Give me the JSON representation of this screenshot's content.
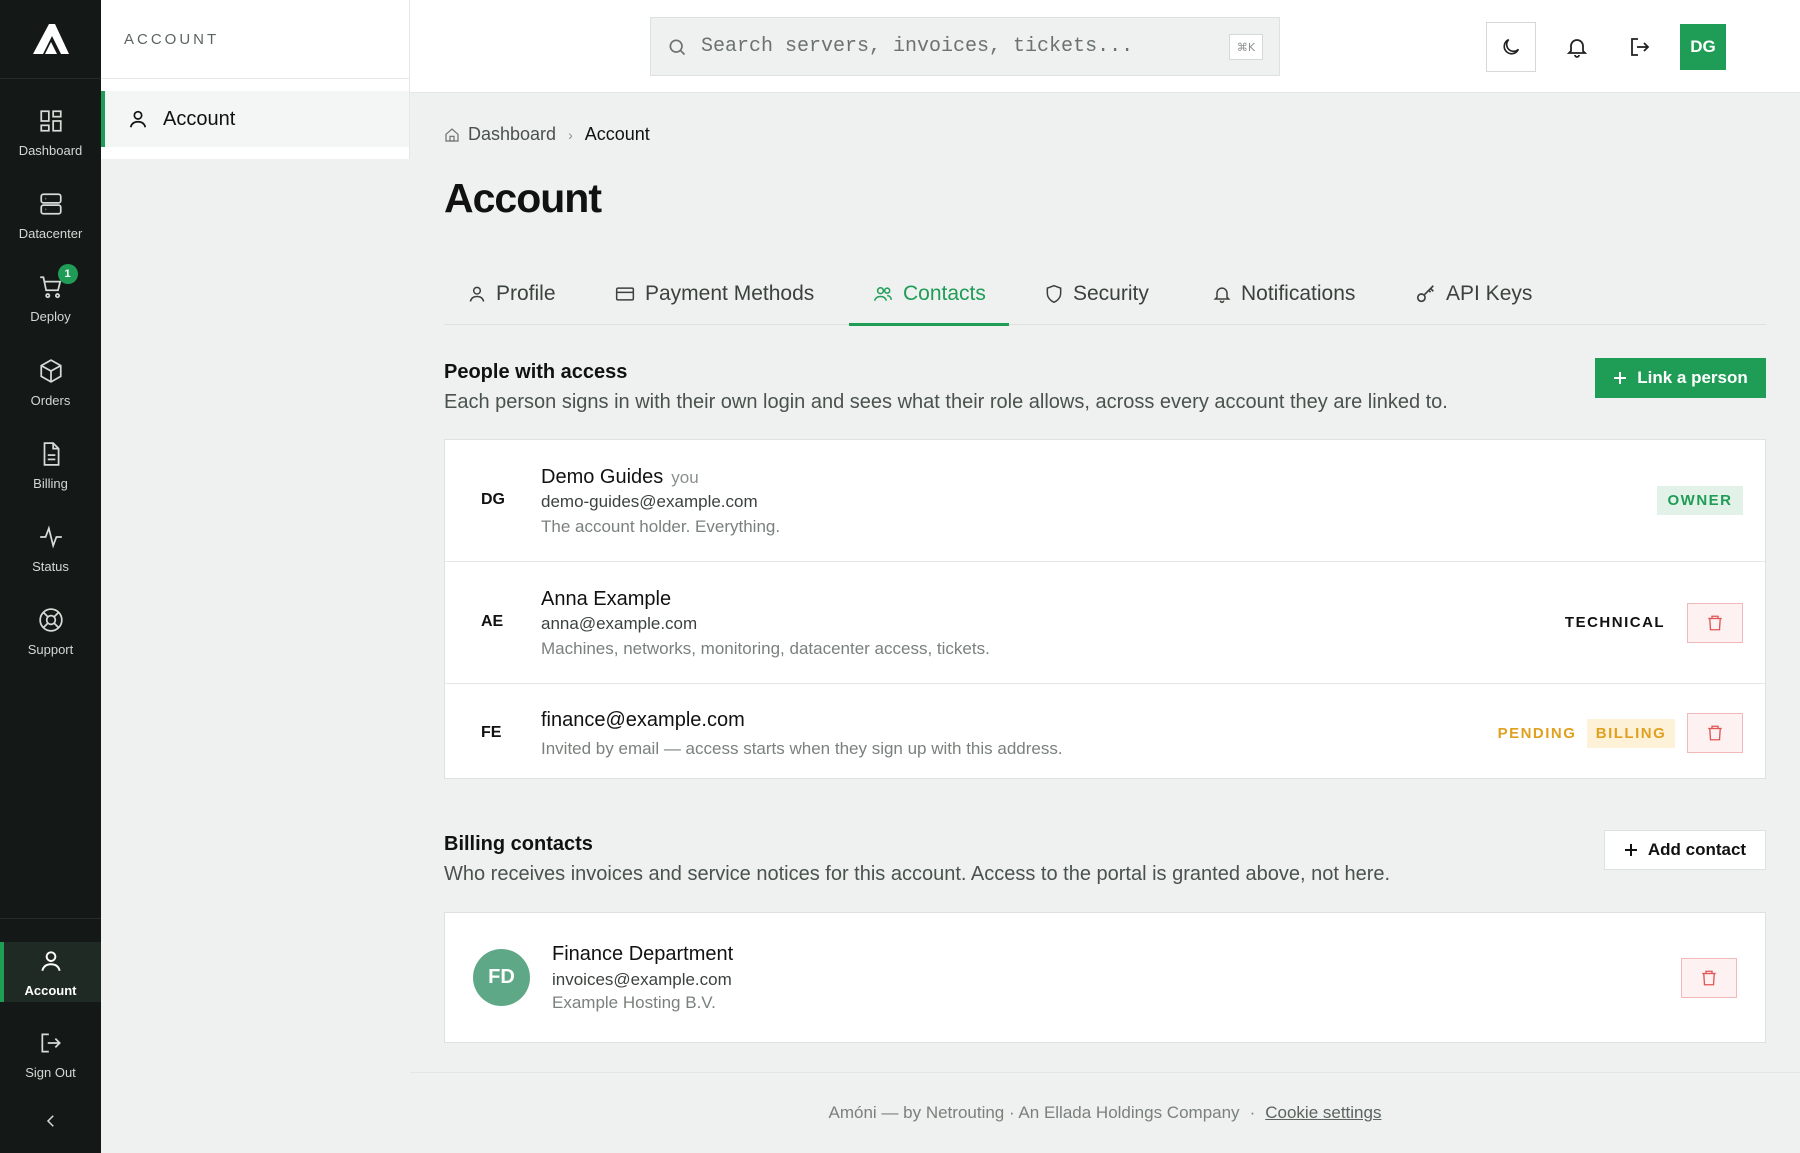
{
  "rail": {
    "items": [
      {
        "label": "Dashboard",
        "icon": "dashboard-grid-icon"
      },
      {
        "label": "Datacenter",
        "icon": "server-icon"
      },
      {
        "label": "Deploy",
        "icon": "cart-icon",
        "badge": "1"
      },
      {
        "label": "Orders",
        "icon": "box-icon"
      },
      {
        "label": "Billing",
        "icon": "document-icon"
      },
      {
        "label": "Status",
        "icon": "activity-icon"
      },
      {
        "label": "Support",
        "icon": "lifebuoy-icon"
      }
    ],
    "bottom": [
      {
        "label": "Account",
        "icon": "user-icon",
        "active": true
      },
      {
        "label": "Sign Out",
        "icon": "sign-out-icon"
      }
    ],
    "collapse_icon": "chevron-left-icon"
  },
  "subnav": {
    "heading": "ACCOUNT",
    "item": "Account"
  },
  "topbar": {
    "search_placeholder": "Search servers, invoices, tickets...",
    "shortcut": "⌘K",
    "avatar": "DG"
  },
  "breadcrumb": {
    "home": "Dashboard",
    "current": "Account"
  },
  "page_title": "Account",
  "tabs": [
    {
      "label": "Profile",
      "icon": "user-icon"
    },
    {
      "label": "Payment Methods",
      "icon": "credit-card-icon"
    },
    {
      "label": "Contacts",
      "icon": "users-icon",
      "active": true
    },
    {
      "label": "Security",
      "icon": "shield-icon"
    },
    {
      "label": "Notifications",
      "icon": "bell-icon"
    },
    {
      "label": "API Keys",
      "icon": "key-icon"
    }
  ],
  "people": {
    "title": "People with access",
    "description": "Each person signs in with their own login and sees what their role allows, across every account they are linked to.",
    "button": "Link a person",
    "rows": [
      {
        "initials": "DG",
        "name": "Demo Guides",
        "you": "you",
        "email": "demo-guides@example.com",
        "note": "The account holder. Everything.",
        "role": "OWNER"
      },
      {
        "initials": "AE",
        "name": "Anna Example",
        "email": "anna@example.com",
        "note": "Machines, networks, monitoring, datacenter access, tickets.",
        "role": "TECHNICAL"
      },
      {
        "initials": "FE",
        "name": "finance@example.com",
        "note": "Invited by email — access starts when they sign up with this address.",
        "status": "PENDING",
        "role": "BILLING"
      }
    ]
  },
  "billing": {
    "title": "Billing contacts",
    "description": "Who receives invoices and service notices for this account. Access to the portal is granted above, not here.",
    "button": "Add contact",
    "contact": {
      "initials": "FD",
      "name": "Finance Department",
      "email": "invoices@example.com",
      "company": "Example Hosting B.V."
    }
  },
  "footer": {
    "text": "Amóni — by Netrouting · An Ellada Holdings Company",
    "dot": "·",
    "link": "Cookie settings"
  },
  "colors": {
    "accent": "#1f9d57",
    "rail_bg": "#141816",
    "danger": "#e05555",
    "warning": "#e0a020"
  }
}
